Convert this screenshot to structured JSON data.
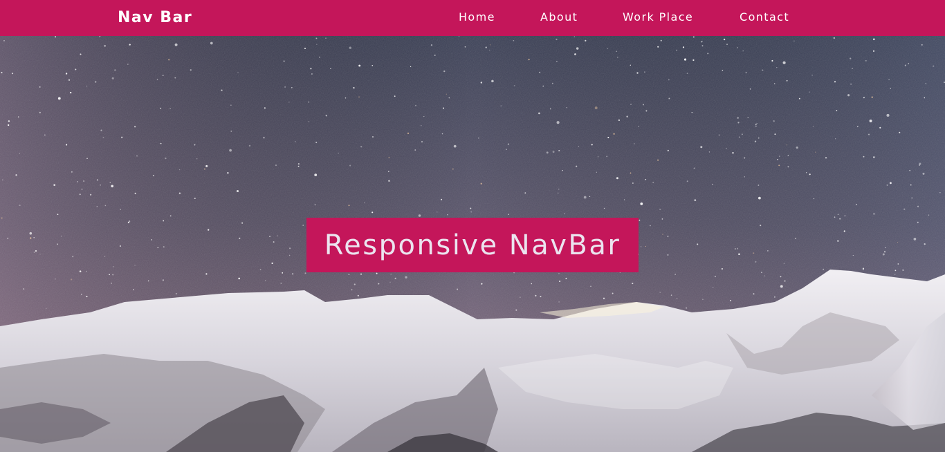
{
  "navbar": {
    "brand": "Nav Bar",
    "links": [
      {
        "label": "Home"
      },
      {
        "label": "About"
      },
      {
        "label": "Work Place"
      },
      {
        "label": "Contact"
      }
    ]
  },
  "hero": {
    "title": "Responsive NavBar",
    "background": "starry-sky-snowy-mountains-photo"
  },
  "colors": {
    "accent": "#c4165a",
    "nav_text": "#ffffff",
    "title_text": "#ebe4ef"
  }
}
